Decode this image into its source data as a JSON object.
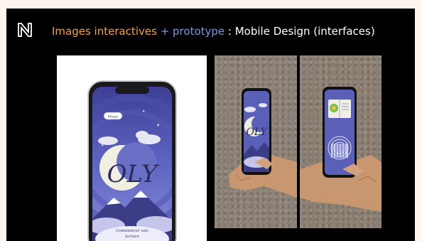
{
  "header": {
    "logo_icon": "n-logo-icon",
    "title_part1": "Images interactives",
    "title_sep1": " + ",
    "title_part2": "prototype",
    "title_sep2": " : ",
    "title_part3": "Mobile Design (interfaces)"
  },
  "colors": {
    "accent_orange": "#f3a23a",
    "accent_blue": "#7d96e0",
    "background": "#000000",
    "app_purple": "#5a5fb8"
  },
  "app_screen": {
    "menu_label": "Menu",
    "logo_text": "OLY",
    "caption_line1": "Commencer une",
    "caption_line2": "lecture"
  },
  "photos": [
    {
      "description_icon": "hand-holding-phone-image"
    },
    {
      "description_icon": "hand-holding-phone-image"
    }
  ]
}
